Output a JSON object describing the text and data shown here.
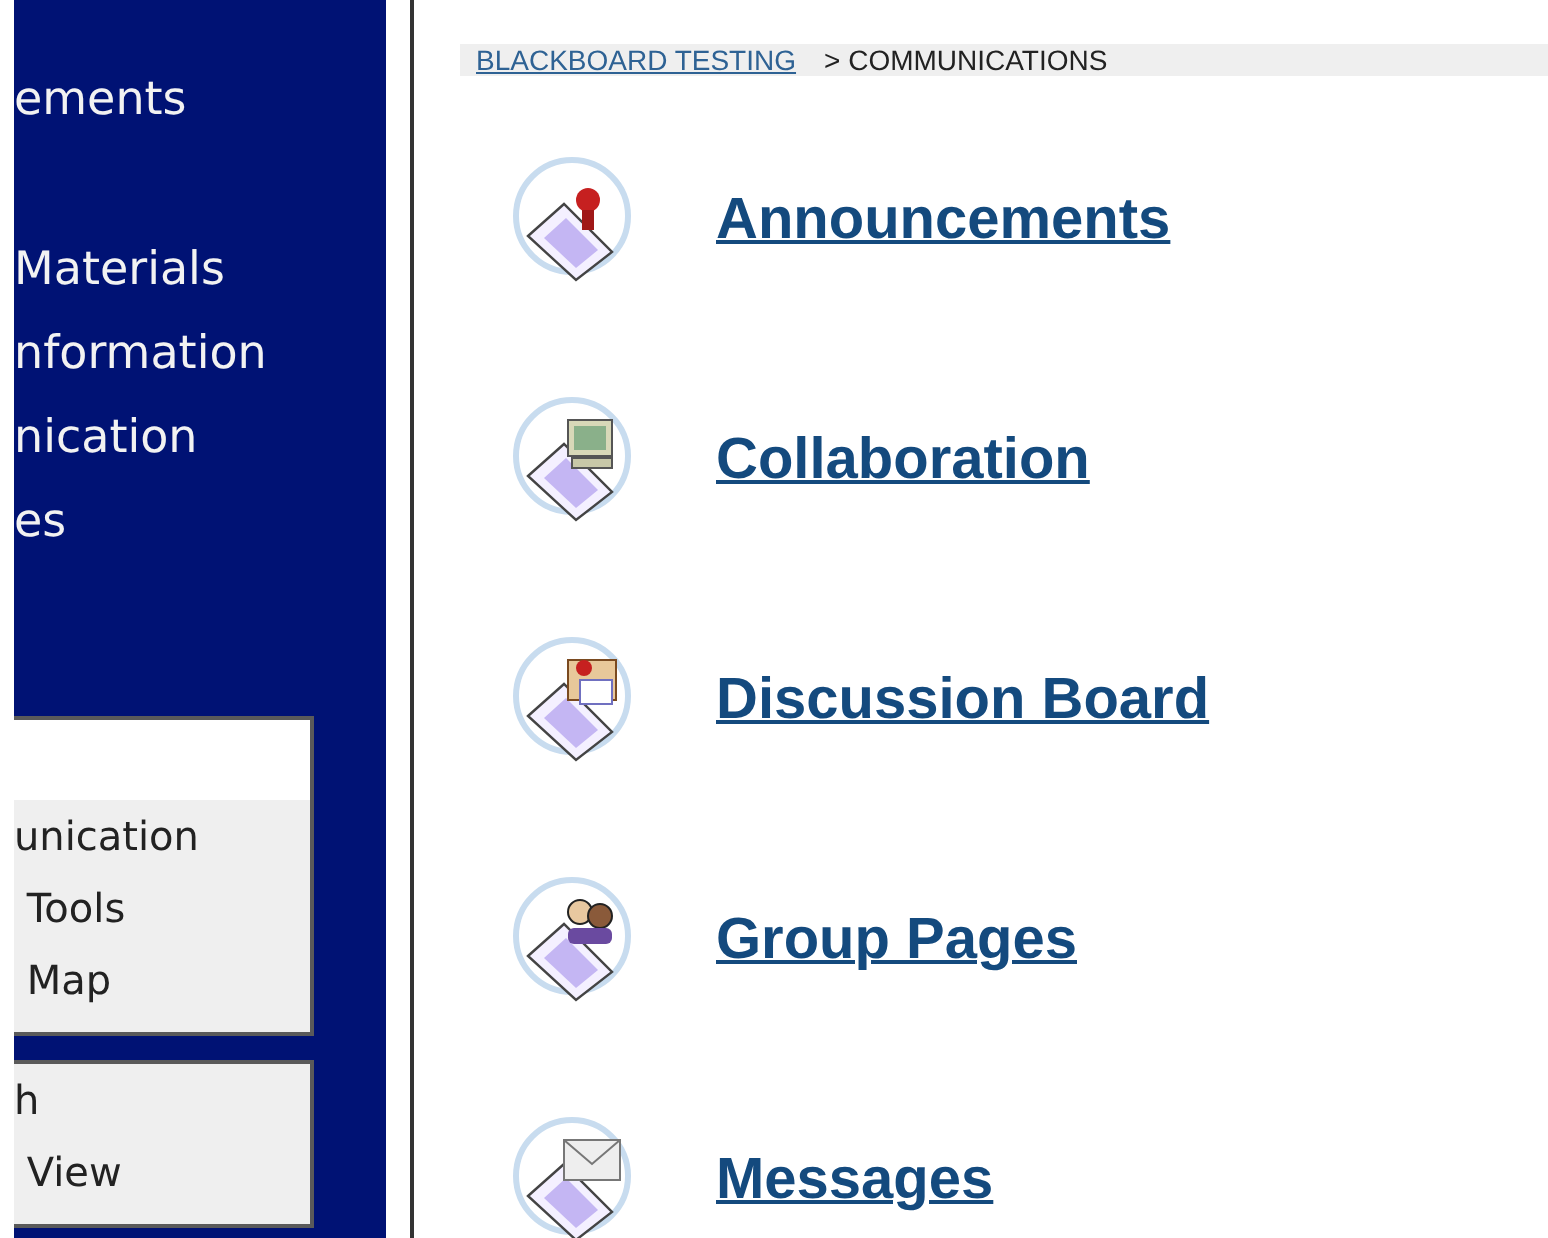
{
  "sidebar": {
    "menu_items": [
      {
        "label": "ements"
      },
      {
        "label": "Materials"
      },
      {
        "label": "nformation"
      },
      {
        "label": "nication"
      },
      {
        "label": "es"
      }
    ],
    "panels": [
      {
        "items": [
          "unication",
          " Tools",
          " Map"
        ],
        "has_header": true
      },
      {
        "items": [
          "h",
          " View"
        ],
        "has_header": false
      }
    ]
  },
  "breadcrumb": {
    "link": "BLACKBOARD TESTING",
    "current": "> COMMUNICATIONS"
  },
  "tools": [
    {
      "label": "Announcements",
      "kind": "pin"
    },
    {
      "label": "Collaboration",
      "kind": "computer"
    },
    {
      "label": "Discussion Board",
      "kind": "board"
    },
    {
      "label": "Group Pages",
      "kind": "people"
    },
    {
      "label": "Messages",
      "kind": "envelope"
    }
  ]
}
